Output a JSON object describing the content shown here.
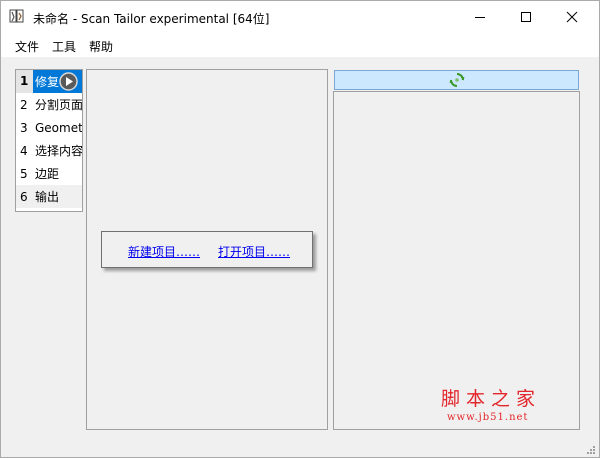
{
  "window": {
    "title": "未命名 - Scan Tailor experimental [64位]"
  },
  "menubar": {
    "items": [
      "文件",
      "工具",
      "帮助"
    ]
  },
  "stages": [
    {
      "num": "1",
      "label": "修复",
      "selected": true
    },
    {
      "num": "2",
      "label": "分割页面"
    },
    {
      "num": "3",
      "label": "Geometr"
    },
    {
      "num": "4",
      "label": "选择内容"
    },
    {
      "num": "5",
      "label": "边距"
    },
    {
      "num": "6",
      "label": "输出"
    }
  ],
  "popup": {
    "new_project": "新建项目……",
    "open_project": "打开项目……"
  },
  "watermark": {
    "title": "脚本之家",
    "url": "www.jb51.net"
  },
  "colors": {
    "selection": "#0078d7",
    "link": "#0000ee",
    "filmstrip_header": "#cce8ff",
    "watermark": "#e3262b"
  },
  "icons": {
    "app": "app-icon",
    "play": "play-icon",
    "reload": "reload-icon"
  }
}
